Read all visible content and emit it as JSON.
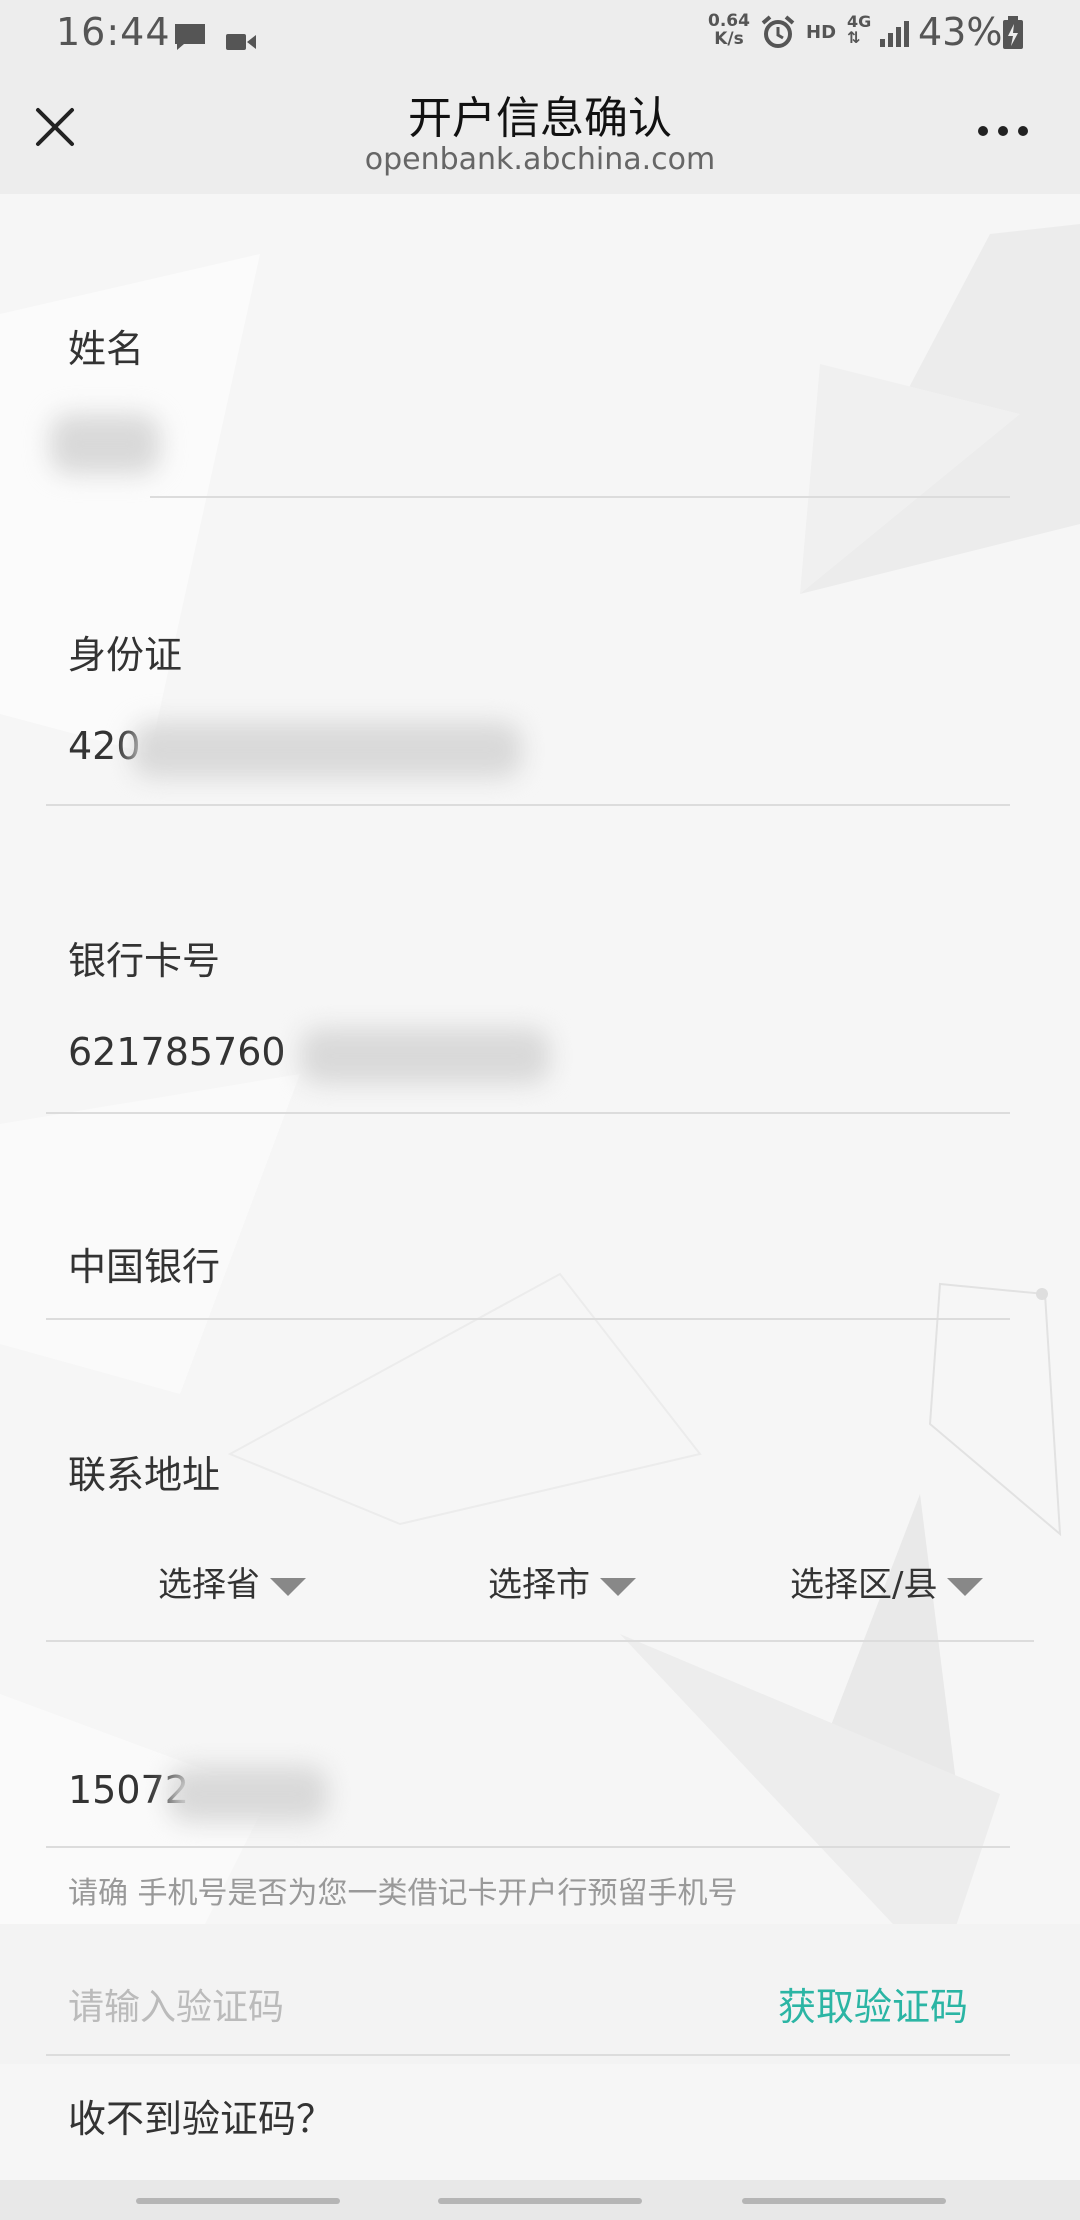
{
  "status_bar": {
    "time": "16:44",
    "speed_value": "0.64",
    "speed_unit": "K/s",
    "hd": "HD",
    "network": "4G",
    "battery": "43%",
    "icons": [
      "message-icon",
      "video-icon",
      "alarm-icon",
      "signal-icon",
      "battery-icon"
    ]
  },
  "title_bar": {
    "title": "开户信息确认",
    "url": "openbank.abchina.com"
  },
  "form": {
    "name_label": "姓名",
    "id_label": "身份证",
    "id_value": "420",
    "card_label": "银行卡号",
    "card_value": "621785760",
    "bank_name": "中国银行",
    "address_label": "联系地址",
    "province_placeholder": "选择省",
    "city_placeholder": "选择市",
    "district_placeholder": "选择区/县",
    "phone_value": "15072",
    "phone_hint": "请确      手机号是否为您一类借记卡开户行预留手机号",
    "code_placeholder": "请输入验证码",
    "get_code_button": "获取验证码",
    "no_code_link": "收不到验证码？"
  },
  "colors": {
    "accent": "#2bb5a4",
    "header_bg": "#ededed",
    "page_bg": "#f6f6f6"
  }
}
